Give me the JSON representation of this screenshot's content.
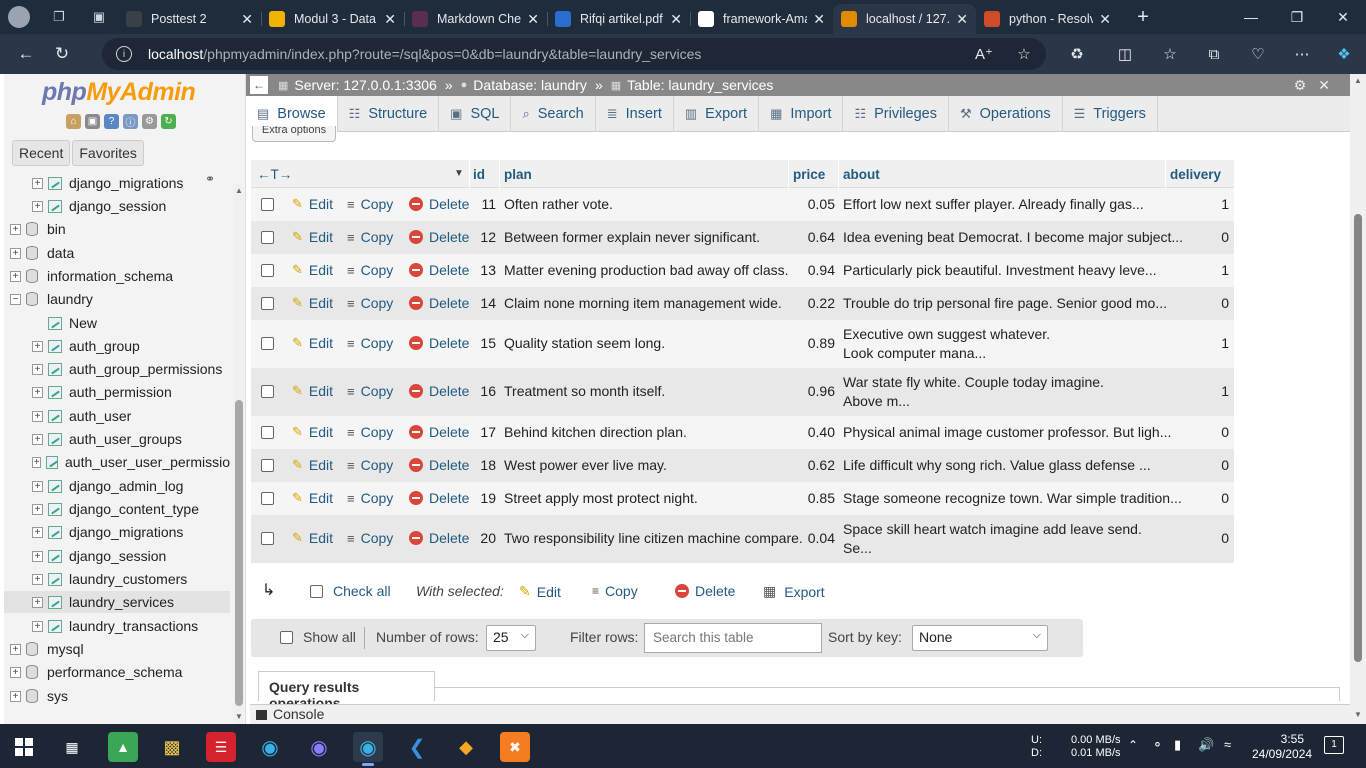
{
  "browser": {
    "tabs": [
      {
        "title": "Posttest 2",
        "color": "#3b3f46"
      },
      {
        "title": "Modul 3 - Data",
        "color": "#f2b200"
      },
      {
        "title": "Markdown Chea",
        "color": "#5a2e4e"
      },
      {
        "title": "Rifqi artikel.pdf",
        "color": "#2b6cd1"
      },
      {
        "title": "framework-Ama",
        "color": "#ffffff"
      },
      {
        "title": "localhost / 127.0",
        "color": "#e08b00"
      },
      {
        "title": "python - Resolv",
        "color": "#d14b2b"
      }
    ],
    "url_host": "localhost",
    "url_path": "/phpmyadmin/index.php?route=/sql&pos=0&db=laundry&table=laundry_services"
  },
  "sidebar": {
    "logo_php": "php",
    "logo_myadmin": "MyAdmin",
    "recent": "Recent",
    "favorites": "Favorites",
    "tree": [
      {
        "label": "django_migrations",
        "level": 2
      },
      {
        "label": "django_session",
        "level": 2
      },
      {
        "label": "bin",
        "level": 1
      },
      {
        "label": "data",
        "level": 1
      },
      {
        "label": "information_schema",
        "level": 1
      },
      {
        "label": "laundry",
        "level": 1,
        "expanded": true
      },
      {
        "label": "New",
        "level": 2,
        "new": true
      },
      {
        "label": "auth_group",
        "level": 2
      },
      {
        "label": "auth_group_permissions",
        "level": 2
      },
      {
        "label": "auth_permission",
        "level": 2
      },
      {
        "label": "auth_user",
        "level": 2
      },
      {
        "label": "auth_user_groups",
        "level": 2
      },
      {
        "label": "auth_user_user_permissio",
        "level": 2
      },
      {
        "label": "django_admin_log",
        "level": 2
      },
      {
        "label": "django_content_type",
        "level": 2
      },
      {
        "label": "django_migrations",
        "level": 2
      },
      {
        "label": "django_session",
        "level": 2
      },
      {
        "label": "laundry_customers",
        "level": 2
      },
      {
        "label": "laundry_services",
        "level": 2,
        "selected": true
      },
      {
        "label": "laundry_transactions",
        "level": 2
      },
      {
        "label": "mysql",
        "level": 1
      },
      {
        "label": "performance_schema",
        "level": 1
      },
      {
        "label": "sys",
        "level": 1
      }
    ]
  },
  "breadcrumb": {
    "server": "Server: 127.0.0.1:3306",
    "database": "Database: laundry",
    "table": "Table: laundry_services"
  },
  "tabs": [
    "Browse",
    "Structure",
    "SQL",
    "Search",
    "Insert",
    "Export",
    "Import",
    "Privileges",
    "Operations",
    "Triggers"
  ],
  "extra_options": "Extra options",
  "table": {
    "columns": [
      "id",
      "plan",
      "price",
      "about",
      "delivery"
    ],
    "actions": {
      "edit": "Edit",
      "copy": "Copy",
      "delete": "Delete"
    },
    "rows": [
      {
        "id": "11",
        "plan": "Often rather vote.",
        "price": "0.05",
        "about": [
          "Effort low next suffer player. Already finally gas..."
        ],
        "delivery": "1"
      },
      {
        "id": "12",
        "plan": "Between former explain never significant.",
        "price": "0.64",
        "about": [
          "Idea evening beat Democrat. I become major subject..."
        ],
        "delivery": "0"
      },
      {
        "id": "13",
        "plan": "Matter evening production bad away off class.",
        "price": "0.94",
        "about": [
          "Particularly pick beautiful. Investment heavy leve..."
        ],
        "delivery": "1"
      },
      {
        "id": "14",
        "plan": "Claim none morning item management wide.",
        "price": "0.22",
        "about": [
          "Trouble do trip personal fire page. Senior good mo..."
        ],
        "delivery": "0"
      },
      {
        "id": "15",
        "plan": "Quality station seem long.",
        "price": "0.89",
        "about": [
          "Executive own suggest whatever.",
          "Look computer mana..."
        ],
        "delivery": "1"
      },
      {
        "id": "16",
        "plan": "Treatment so month itself.",
        "price": "0.96",
        "about": [
          "War state fly white. Couple today imagine.",
          "Above m..."
        ],
        "delivery": "1"
      },
      {
        "id": "17",
        "plan": "Behind kitchen direction plan.",
        "price": "0.40",
        "about": [
          "Physical animal image customer professor. But ligh..."
        ],
        "delivery": "0"
      },
      {
        "id": "18",
        "plan": "West power ever live may.",
        "price": "0.62",
        "about": [
          "Life difficult why song rich. Value glass defense ..."
        ],
        "delivery": "0"
      },
      {
        "id": "19",
        "plan": "Street apply most protect night.",
        "price": "0.85",
        "about": [
          "Stage someone recognize town. War simple tradition..."
        ],
        "delivery": "0"
      },
      {
        "id": "20",
        "plan": "Two responsibility line citizen machine compare.",
        "price": "0.04",
        "about": [
          "Space skill heart watch imagine add leave send.",
          "Se..."
        ],
        "delivery": "0"
      }
    ]
  },
  "with_selected": {
    "check_all": "Check all",
    "label": "With selected:",
    "edit": "Edit",
    "copy": "Copy",
    "delete": "Delete",
    "export": "Export"
  },
  "rows_bar": {
    "show_all": "Show all",
    "number_of_rows_label": "Number of rows:",
    "number_of_rows": "25",
    "filter_label": "Filter rows:",
    "filter_placeholder": "Search this table",
    "sort_label": "Sort by key:",
    "sort_value": "None"
  },
  "query_results_operations": "Query results operations",
  "console": "Console",
  "taskbar": {
    "net_up_label": "U:",
    "net_down_label": "D:",
    "net_up": "0.00 MB/s",
    "net_down": "0.01 MB/s",
    "time": "3:55",
    "date": "24/09/2024",
    "notifications": "1"
  }
}
